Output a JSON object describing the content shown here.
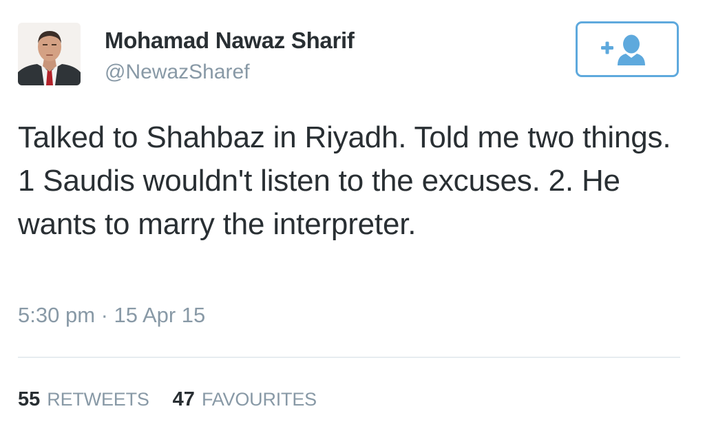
{
  "author": {
    "display_name": "Mohamad Nawaz Sharif",
    "screen_name": "@NewazSharef",
    "avatar_icon": "profile-photo"
  },
  "follow_button": {
    "icon": "add-user-icon",
    "color": "#5ea9dd"
  },
  "tweet": {
    "text": "Talked to Shahbaz in Riyadh. Told me two things. 1 Saudis wouldn't listen to the excuses. 2. He wants to marry the interpreter.",
    "timestamp": "5:30 pm · 15 Apr 15"
  },
  "stats": {
    "retweets": {
      "count": "55",
      "label": "RETWEETS"
    },
    "favourites": {
      "count": "47",
      "label": "FAVOURITES"
    }
  },
  "colors": {
    "text": "#292f33",
    "muted": "#8899a6",
    "accent": "#5ea9dd",
    "divider": "#e6ecf0"
  }
}
